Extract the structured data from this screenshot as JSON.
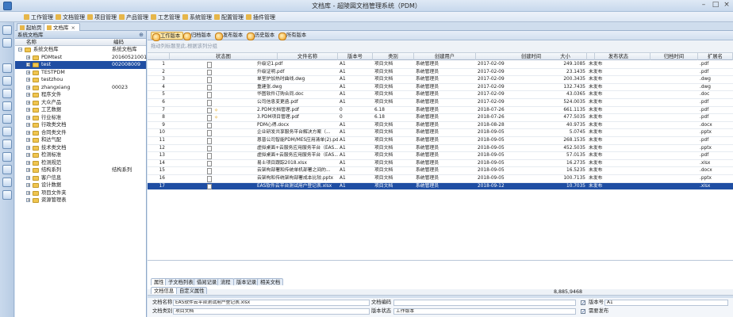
{
  "window": {
    "title": "文档库 - 超陵図文档管理系统（PDM）"
  },
  "menu": [
    "工作管理",
    "文档管理",
    "项目管理",
    "产品管理",
    "工艺管理",
    "系统管理",
    "配置管理",
    "插件管理"
  ],
  "doc_tabs": [
    {
      "label": "起始页",
      "active": false
    },
    {
      "label": "文档库",
      "active": true
    }
  ],
  "tree": {
    "header": "系统文档库",
    "col_name": "名称",
    "col_code": "编码",
    "rows": [
      {
        "name": "系统文档库",
        "code": "系统文档库",
        "level": 0,
        "selected": false
      },
      {
        "name": "PDMtest",
        "code": "20160521001",
        "level": 1,
        "selected": false
      },
      {
        "name": "test",
        "code": "002008009",
        "level": 1,
        "selected": true
      },
      {
        "name": "TESTPDM",
        "code": "",
        "level": 1,
        "selected": false
      },
      {
        "name": "testzhou",
        "code": "",
        "level": 1,
        "selected": false
      },
      {
        "name": "zhangxiang",
        "code": "00023",
        "level": 1,
        "selected": false
      },
      {
        "name": "程序文件",
        "code": "",
        "level": 1,
        "selected": false
      },
      {
        "name": "大众产品",
        "code": "",
        "level": 1,
        "selected": false
      },
      {
        "name": "工艺数据",
        "code": "",
        "level": 1,
        "selected": false
      },
      {
        "name": "行业标准",
        "code": "",
        "level": 1,
        "selected": false
      },
      {
        "name": "行政类文档",
        "code": "",
        "level": 1,
        "selected": false
      },
      {
        "name": "合同类文件",
        "code": "",
        "level": 1,
        "selected": false
      },
      {
        "name": "和达气配",
        "code": "",
        "level": 1,
        "selected": false
      },
      {
        "name": "技术类文档",
        "code": "",
        "level": 1,
        "selected": false
      },
      {
        "name": "检测标准",
        "code": "",
        "level": 1,
        "selected": false
      },
      {
        "name": "检测规范",
        "code": "",
        "level": 1,
        "selected": false
      },
      {
        "name": "结构系列",
        "code": "结构系列",
        "level": 1,
        "selected": false
      },
      {
        "name": "客户信息",
        "code": "",
        "level": 1,
        "selected": false
      },
      {
        "name": "设计数据",
        "code": "",
        "level": 1,
        "selected": false
      },
      {
        "name": "项目文件夹",
        "code": "",
        "level": 1,
        "selected": false
      },
      {
        "name": "资源管理表",
        "code": "",
        "level": 1,
        "selected": false
      }
    ]
  },
  "toolbar": [
    "工作版本",
    "归档版本",
    "发布版本",
    "历史版本",
    "所有版本"
  ],
  "group_hint": "拖动列标题至此,根据该列分组",
  "grid": {
    "columns": [
      "状态图",
      "文件名称",
      "版本号",
      "类别",
      "创建用户",
      "创建时间",
      "大小",
      "发布状态",
      "归档时间",
      "扩展名"
    ],
    "rows": [
      {
        "n": "1",
        "file": "升级记1.pdf",
        "ver": "A1",
        "cat": "项目文档",
        "user": "系统管理员",
        "time": "2017-02-09",
        "size": "249.1085",
        "status": "未发布",
        "ext": ".pdf",
        "flag": false
      },
      {
        "n": "2",
        "file": "升级证明.pdf",
        "ver": "A1",
        "cat": "项目文档",
        "user": "系统管理员",
        "time": "2017-02-09",
        "size": "23.1435",
        "status": "未发布",
        "ext": ".pdf",
        "flag": false
      },
      {
        "n": "3",
        "file": "单室炉加热时曲线.dwg",
        "ver": "A1",
        "cat": "项目文档",
        "user": "系统管理员",
        "time": "2017-02-09",
        "size": "200.3435",
        "status": "未发布",
        "ext": ".dwg",
        "flag": false
      },
      {
        "n": "4",
        "file": "重建张.dwg",
        "ver": "A1",
        "cat": "项目文档",
        "user": "系统管理员",
        "time": "2017-02-09",
        "size": "132.7435",
        "status": "未发布",
        "ext": ".dwg",
        "flag": false
      },
      {
        "n": "5",
        "file": "华图软件订购合同.doc",
        "ver": "A1",
        "cat": "项目文档",
        "user": "系统管理员",
        "time": "2017-02-09",
        "size": "43.0365",
        "status": "未发布",
        "ext": ".doc",
        "flag": false
      },
      {
        "n": "6",
        "file": "公司信息变更函.pdf",
        "ver": "A1",
        "cat": "项目文档",
        "user": "系统管理员",
        "time": "2017-02-09",
        "size": "524.0035",
        "status": "未发布",
        "ext": ".pdf",
        "flag": false
      },
      {
        "n": "7",
        "file": "2.PDM文档管理.pdf",
        "ver": "0",
        "cat": "6.18",
        "user": "系统管理员",
        "time": "2018-07-26",
        "size": "661.1135",
        "status": "未发布",
        "ext": ".pdf",
        "flag": true
      },
      {
        "n": "8",
        "file": "3.PDM项目管理.pdf",
        "ver": "0",
        "cat": "6.18",
        "user": "系统管理员",
        "time": "2018-07-26",
        "size": "477.5035",
        "status": "未发布",
        "ext": ".pdf",
        "flag": true
      },
      {
        "n": "9",
        "file": "PDM心得.docx",
        "ver": "A1",
        "cat": "项目文档",
        "user": "系统管理员",
        "time": "2018-08-28",
        "size": "40.9735",
        "status": "未发布",
        "ext": ".docx",
        "flag": false
      },
      {
        "n": "10",
        "file": "企业研发共享服务平台解决方案（...",
        "ver": "A1",
        "cat": "项目文档",
        "user": "系统管理员",
        "time": "2018-09-05",
        "size": "5.0745",
        "status": "未发布",
        "ext": ".pptx",
        "flag": false
      },
      {
        "n": "11",
        "file": "恩普公司智能PDM/MES应用清单(2).pdf",
        "ver": "A1",
        "cat": "项目文档",
        "user": "系统管理员",
        "time": "2018-09-05",
        "size": "268.1535",
        "status": "未发布",
        "ext": ".pdf",
        "flag": false
      },
      {
        "n": "12",
        "file": "虚拟桌面+云服务应用服务平台（EAS...",
        "ver": "A1",
        "cat": "项目文档",
        "user": "系统管理员",
        "time": "2018-09-05",
        "size": "452.5035",
        "status": "未发布",
        "ext": ".pptx",
        "flag": false
      },
      {
        "n": "13",
        "file": "虚拟桌面+云服务应用服务平台（EAS...",
        "ver": "A1",
        "cat": "项目文档",
        "user": "系统管理员",
        "time": "2018-09-05",
        "size": "57.0135",
        "status": "未发布",
        "ext": ".pdf",
        "flag": false
      },
      {
        "n": "14",
        "file": "易士项目跟踪2018.xlsx",
        "ver": "A1",
        "cat": "项目文档",
        "user": "系统管理员",
        "time": "2018-09-05",
        "size": "16.2735",
        "status": "未发布",
        "ext": ".xlsx",
        "flag": false
      },
      {
        "n": "15",
        "file": "云架构部署和传统单机部署之间的...",
        "ver": "A1",
        "cat": "项目文档",
        "user": "系统管理员",
        "time": "2018-09-05",
        "size": "16.5235",
        "status": "未发布",
        "ext": ".docx",
        "flag": false
      },
      {
        "n": "16",
        "file": "云架构和传统架构部署成本比较.pptx",
        "ver": "A1",
        "cat": "项目文档",
        "user": "系统管理员",
        "time": "2018-09-05",
        "size": "100.7135",
        "status": "未发布",
        "ext": ".pptx",
        "flag": false
      },
      {
        "n": "17",
        "file": "EAS软件云平台测试用户登记表.xlsx",
        "ver": "A1",
        "cat": "项目文档",
        "user": "系统管理员",
        "time": "2018-09-12",
        "size": "10.7035",
        "status": "未发布",
        "ext": ".xlsx",
        "flag": false,
        "selected": true
      }
    ],
    "total_size": "8,885,9468"
  },
  "prop_tabs_top": [
    "属性",
    "子文档列表",
    "借阅记录",
    "流程",
    "版本记录",
    "相关文档"
  ],
  "prop_tabs_sub": [
    "文档信息",
    "自定义属性"
  ],
  "props": {
    "doc_name_label": "文档名称",
    "doc_name_value": "EAS软件云平台测试用户登记表.xlsx",
    "doc_code_label": "文档编码",
    "doc_code_value": "",
    "version_label": "版本号",
    "version_value": "A1",
    "doc_type_label": "文档类别",
    "doc_type_value": "项目文档",
    "version_status_label": "版本状态",
    "version_status_value": "工作版本",
    "need_publish_label": "需要发布"
  }
}
